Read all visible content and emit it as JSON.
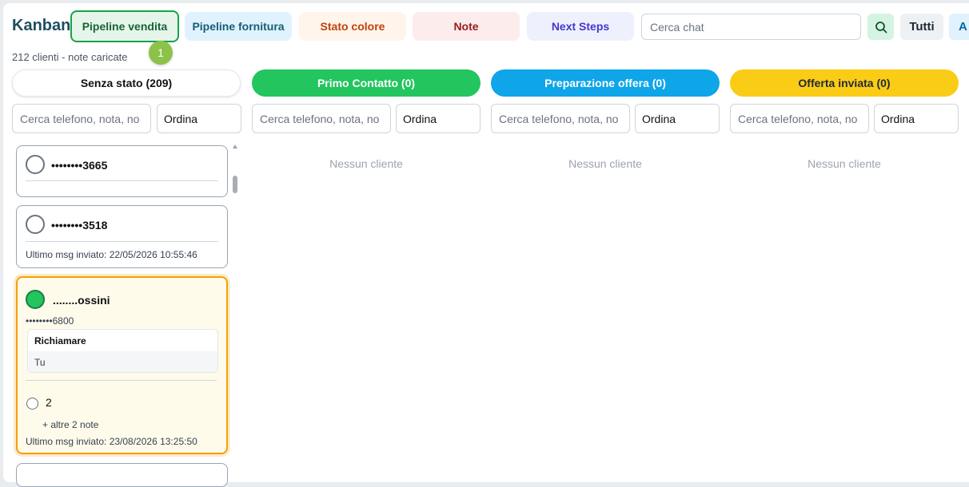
{
  "app": {
    "title": "Kanban"
  },
  "tabs": [
    {
      "label": "Pipeline vendita"
    },
    {
      "label": "Pipeline fornitura"
    },
    {
      "label": "Stato colore"
    },
    {
      "label": "Note"
    },
    {
      "label": "Next Steps"
    }
  ],
  "badge": {
    "value": "1"
  },
  "search": {
    "placeholder": "Cerca chat"
  },
  "buttons": {
    "tutti": "Tutti",
    "a": "A"
  },
  "summary": "212 clienti - note caricate",
  "columns": [
    {
      "title": "Senza stato (209)",
      "color": "#ffffff",
      "search_placeholder": "Cerca telefono, nota, no",
      "sort_label": "Ordina"
    },
    {
      "title": "Primo Contatto (0)",
      "color": "#22c55e",
      "search_placeholder": "Cerca telefono, nota, no",
      "sort_label": "Ordina",
      "empty": "Nessun cliente"
    },
    {
      "title": "Preparazione offera (0)",
      "color": "#0ea5e9",
      "search_placeholder": "Cerca telefono, nota, no",
      "sort_label": "Ordina",
      "empty": "Nessun cliente"
    },
    {
      "title": "Offerta inviata (0)",
      "color": "#facc15",
      "search_placeholder": "Cerca telefono, nota, no",
      "sort_label": "Ordina",
      "empty": "Nessun cliente"
    }
  ],
  "cards": [
    {
      "name": "••••••••3665"
    },
    {
      "name": "••••••••3518",
      "last_msg": "Ultimo msg inviato: 22/05/2026 10:55:46"
    },
    {
      "name": "........ossini",
      "phone": "••••••••6800",
      "note_title": "Richiamare",
      "note_author": "Tu",
      "task_label": "2",
      "more_notes": "+ altre 2 note",
      "last_msg": "Ultimo msg inviato: 23/08/2026 13:25:50"
    }
  ]
}
